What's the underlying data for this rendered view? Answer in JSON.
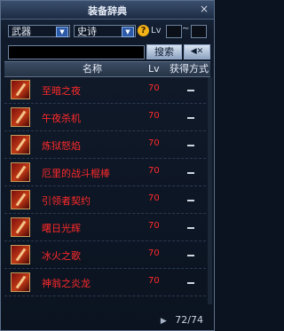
{
  "window": {
    "title": "装备辞典",
    "close": "×"
  },
  "filters": {
    "category": "武器",
    "rarity": "史诗",
    "help": "?",
    "lv_label": "Lv",
    "range_sep": "~"
  },
  "search": {
    "value": "",
    "search_label": "搜索",
    "clear_label": "◀✕"
  },
  "columns": {
    "name": "名称",
    "lv": "Lv",
    "method": "获得方式"
  },
  "items": [
    {
      "name": "至暗之夜",
      "level": "70"
    },
    {
      "name": "午夜杀机",
      "level": "70"
    },
    {
      "name": "炼狱怒焰",
      "level": "70"
    },
    {
      "name": "厄里的战斗棍棒",
      "level": "70"
    },
    {
      "name": "引领者契约",
      "level": "70"
    },
    {
      "name": "曙日光辉",
      "level": "70"
    },
    {
      "name": "冰火之歌",
      "level": "70"
    },
    {
      "name": "神翁之炎龙",
      "level": "70"
    }
  ],
  "pager": {
    "text": "72/74",
    "arrow": "▶"
  }
}
